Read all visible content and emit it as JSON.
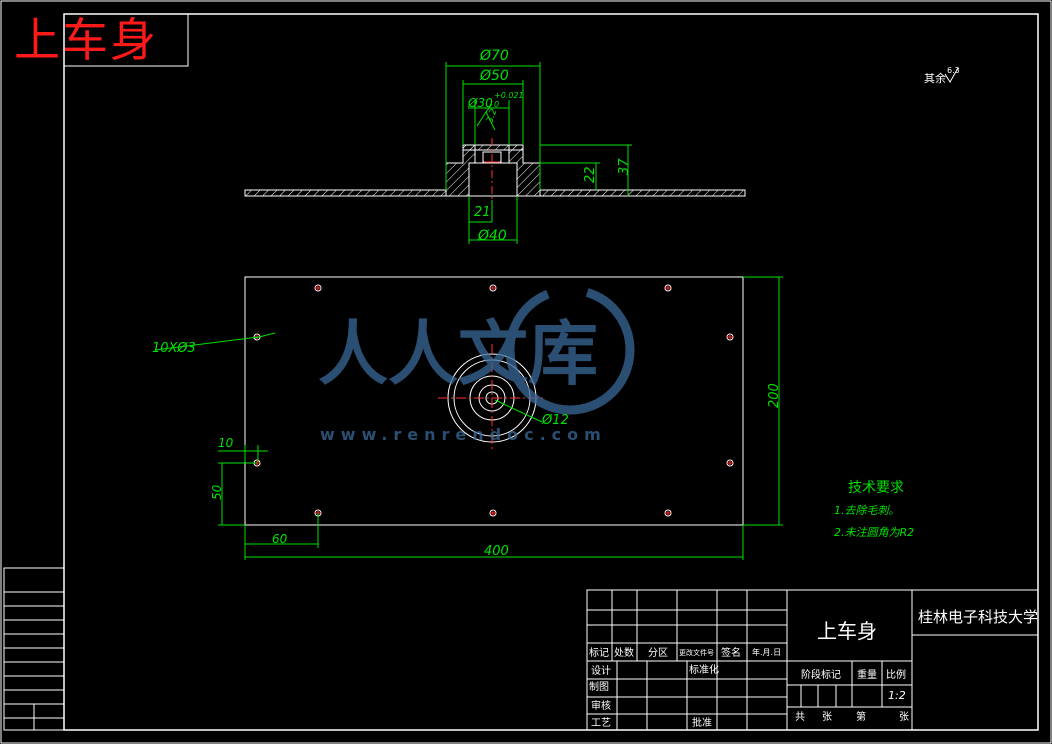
{
  "corner_title": "上车身",
  "surface_finish_note": "其余",
  "surface_finish_value": "6.3",
  "section_dims": {
    "d70": "Ø70",
    "d50": "Ø50",
    "d30": "Ø30",
    "d30_tol": "+0.021",
    "d30_tol2": "0",
    "rough": "3.2",
    "h37": "37",
    "h22": "22",
    "h21": "21",
    "d40": "Ø40"
  },
  "plan_dims": {
    "holes": "10XØ3",
    "d12": "Ø12",
    "d10": "10",
    "d50": "50",
    "d60": "60",
    "d400": "400",
    "d200": "200"
  },
  "tech_requirements": {
    "title": "技术要求",
    "items": [
      "1.去除毛刺。",
      "2.未注圆角为R2"
    ]
  },
  "watermark": {
    "text": "人人文库",
    "url": "www.renrendoc.com"
  },
  "title_block": {
    "part_name": "上车身",
    "school": "桂林电子科技大学",
    "headers": [
      "标记",
      "处数",
      "分区",
      "更改文件号",
      "签名",
      "年.月.日"
    ],
    "design": "设计",
    "standardization": "标准化",
    "drafting": "制图",
    "review": "审核",
    "process": "工艺",
    "approve": "批准",
    "stage_mark": "阶段标记",
    "weight": "重量",
    "scale_label": "比例",
    "scale_value": "1:2",
    "total": "共",
    "sheet": "张",
    "page": "第",
    "sheet2": "张"
  }
}
